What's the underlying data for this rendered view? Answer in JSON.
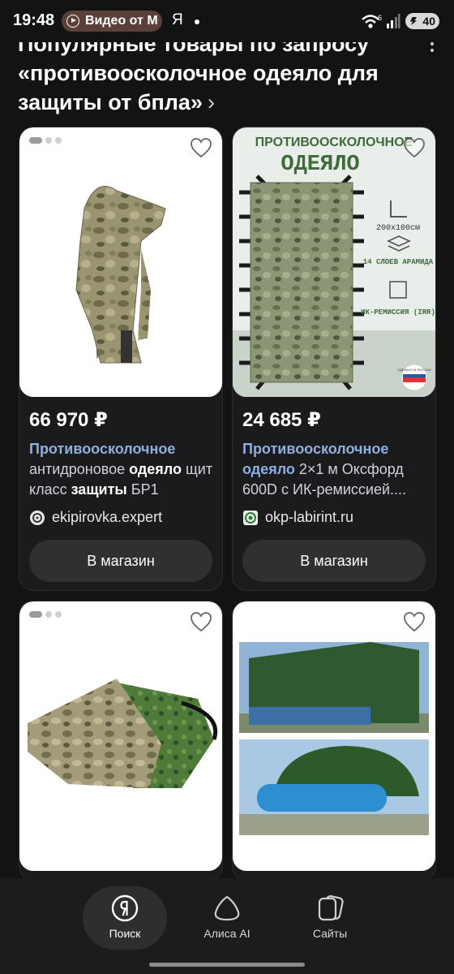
{
  "status_bar": {
    "time": "19:48",
    "media_pill": "Видео от М",
    "app_letter": "Я",
    "battery": "40",
    "wifi_badge": "6"
  },
  "section": {
    "title": "Популярные товары по запросу «противоосколочное одеяло для защиты от бпла»",
    "chevron": "›"
  },
  "products": [
    {
      "price": "66 970 ₽",
      "desc_parts": [
        {
          "text": "Противоосколочное",
          "style": "hl"
        },
        {
          "text": " антидроновое ",
          "style": "plain"
        },
        {
          "text": "одеяло",
          "style": "hlw"
        },
        {
          "text": " щит класс ",
          "style": "plain"
        },
        {
          "text": "защиты",
          "style": "hlw"
        },
        {
          "text": " БР1",
          "style": "plain"
        }
      ],
      "shop": "ekipirovka.expert",
      "button": "В магазин"
    },
    {
      "price": "24 685 ₽",
      "image_text": {
        "line1": "ПРОТИВООСКОЛОЧНОЕ",
        "line2": "ОДЕЯЛО",
        "size": "200х100см",
        "layers": "14 СЛОЕВ АРАМИДА",
        "irr": "ИК-РЕМИССИЯ (IRR)",
        "made": "СДЕЛАНО В РОССИИ"
      },
      "desc_parts": [
        {
          "text": "Противоосколочное",
          "style": "hl"
        },
        {
          "text": " ",
          "style": "plain"
        },
        {
          "text": "одеяло",
          "style": "hl"
        },
        {
          "text": " 2×1 м Оксфорд 600D с ИК-ремиссией....",
          "style": "plain"
        }
      ],
      "shop": "okp-labirint.ru",
      "button": "В магазин"
    }
  ],
  "bottom_nav": [
    {
      "label": "Поиск",
      "icon": "yandex-search-icon",
      "active": true
    },
    {
      "label": "Алиса AI",
      "icon": "alice-icon",
      "active": false
    },
    {
      "label": "Сайты",
      "icon": "tabs-icon",
      "active": false
    }
  ],
  "colors": {
    "background": "#131314",
    "card": "#1b1b1d",
    "link_blue": "#8eb0e0",
    "button": "#303033",
    "nav_bar": "#1c1c1e"
  }
}
